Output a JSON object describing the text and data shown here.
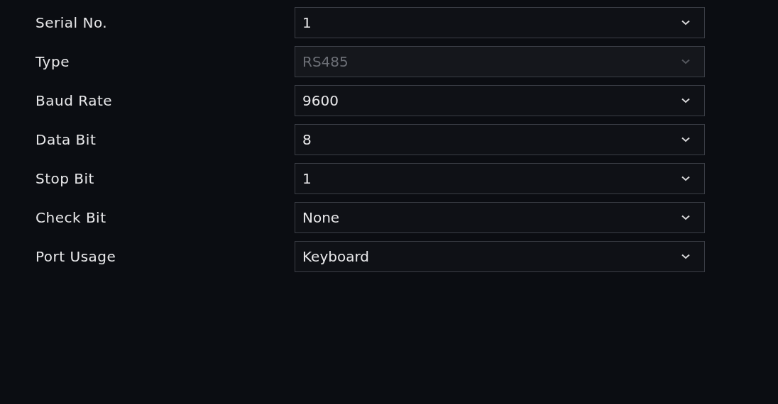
{
  "fields": [
    {
      "label": "Serial No.",
      "value": "1",
      "disabled": false
    },
    {
      "label": "Type",
      "value": "RS485",
      "disabled": true
    },
    {
      "label": "Baud Rate",
      "value": "9600",
      "disabled": false
    },
    {
      "label": "Data Bit",
      "value": "8",
      "disabled": false
    },
    {
      "label": "Stop Bit",
      "value": "1",
      "disabled": false
    },
    {
      "label": "Check Bit",
      "value": "None",
      "disabled": false
    },
    {
      "label": "Port Usage",
      "value": "Keyboard",
      "disabled": false
    }
  ]
}
